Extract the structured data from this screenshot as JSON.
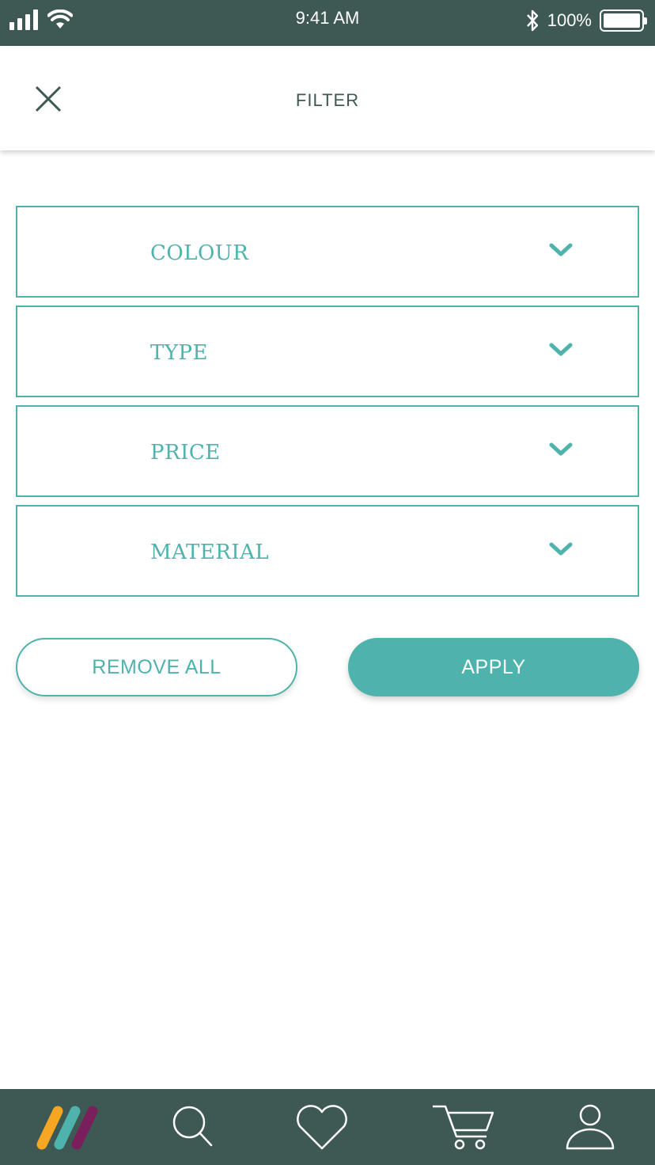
{
  "status_bar": {
    "time": "9:41 AM",
    "battery_text": "100%",
    "icons": [
      "signal-icon",
      "wifi-icon",
      "bluetooth-icon",
      "battery-icon"
    ]
  },
  "header": {
    "title": "FILTER",
    "close_icon": "close-icon"
  },
  "filters": [
    {
      "label": "COLOUR"
    },
    {
      "label": "TYPE"
    },
    {
      "label": "PRICE"
    },
    {
      "label": "MATERIAL"
    }
  ],
  "actions": {
    "remove_all_label": "REMOVE ALL",
    "apply_label": "APPLY"
  },
  "tab_bar": {
    "items": [
      "home-logo-icon",
      "search-icon",
      "heart-icon",
      "cart-icon",
      "profile-icon"
    ]
  },
  "colors": {
    "accent": "#4db3ac",
    "dark": "#3e5853",
    "logo_orange": "#f5a623",
    "logo_teal": "#4db3ac",
    "logo_purple": "#7a1f5c"
  }
}
